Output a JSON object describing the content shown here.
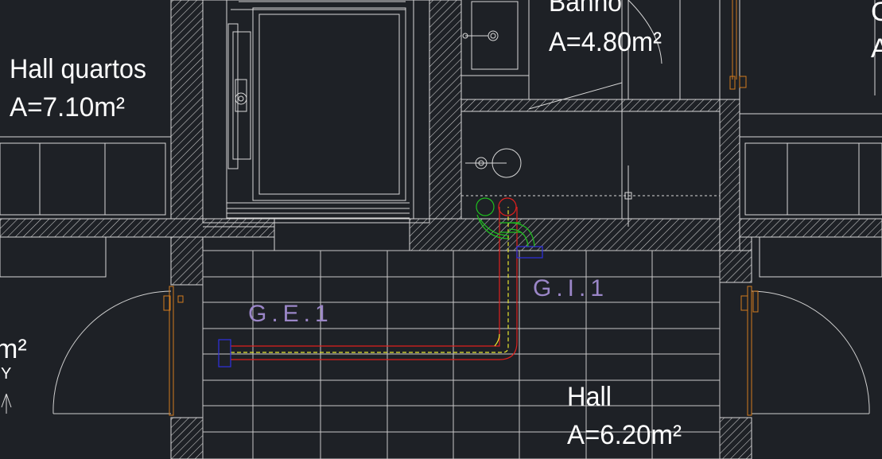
{
  "colors": {
    "background": "#1e2126",
    "lines": "#d8d8d8",
    "text": "#ffffff",
    "tag_text": "#9b86c8",
    "duct_red": "#e0201e",
    "duct_yellow": "#e8e830",
    "green_circle": "#1fbf1f",
    "blue_marker": "#3030e0",
    "door_orange": "#d37b1e"
  },
  "rooms": {
    "hall_quartos": {
      "name": "Hall quartos",
      "area": "A=7.10m²"
    },
    "banho": {
      "name": "Banho",
      "area": "A=4.80m²"
    },
    "hall": {
      "name": "Hall",
      "area": "A=6.20m²"
    },
    "left_partial": {
      "area_fragment": "m²",
      "axis_letter": "Y"
    },
    "right_partial": {
      "name_fragment": "C",
      "area_fragment": "A"
    }
  },
  "tags": {
    "ge1": "G.E.1",
    "gi1": "G.I.1"
  },
  "icons": [
    "hatched-wall-icon",
    "door-swing-icon",
    "washbasin-icon",
    "bidet-icon",
    "elevator-icon",
    "duct-run-icon"
  ]
}
